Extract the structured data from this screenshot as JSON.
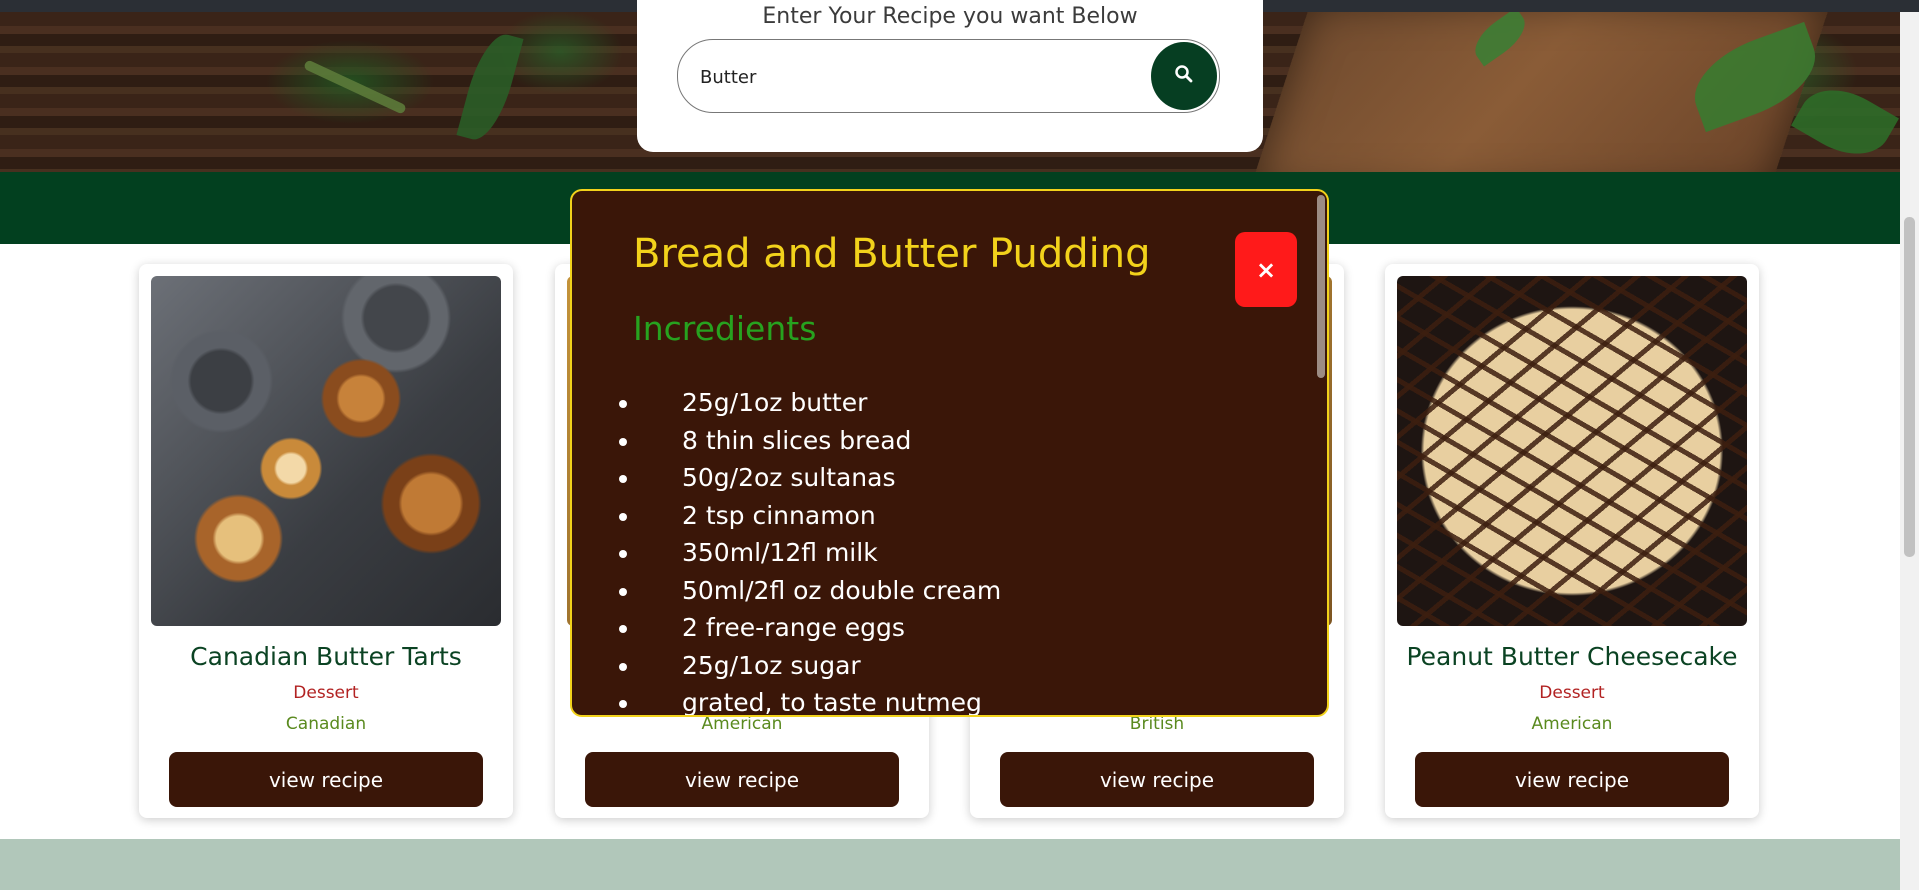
{
  "search": {
    "label": "Enter Your Recipe you want Below",
    "value": "Butter",
    "button_icon": "search-icon"
  },
  "cards": [
    {
      "title": "Canadian Butter Tarts",
      "category": "Dessert",
      "area": "Canadian",
      "button": "view recipe"
    },
    {
      "title": "",
      "category": "",
      "area": "American",
      "button": "view recipe"
    },
    {
      "title": "",
      "category": "",
      "area": "British",
      "button": "view recipe"
    },
    {
      "title": "Peanut Butter Cheesecake",
      "category": "Dessert",
      "area": "American",
      "button": "view recipe"
    }
  ],
  "modal": {
    "title": "Bread and Butter Pudding",
    "close_label": "×",
    "ingredients_heading": "Incredients",
    "ingredients": [
      "25g/1oz butter",
      "8 thin slices bread",
      "50g/2oz sultanas",
      "2 tsp cinnamon",
      "350ml/12fl milk",
      "50ml/2fl oz double cream",
      "2 free-range eggs",
      "25g/1oz sugar",
      "grated, to taste nutmeg"
    ]
  },
  "colors": {
    "accent_green": "#02401f",
    "button_brown": "#3a1608",
    "modal_title": "#f2d21b",
    "close_red": "#ff1a1a"
  }
}
